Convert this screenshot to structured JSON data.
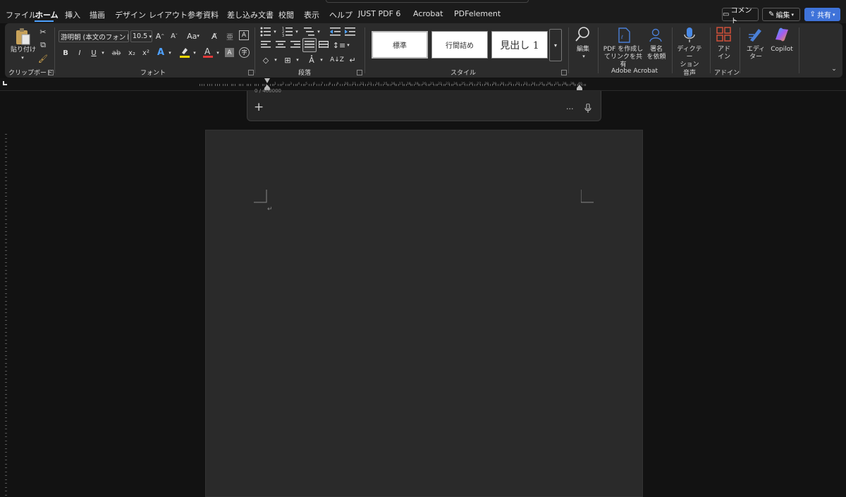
{
  "tabs": [
    "ファイル",
    "ホーム",
    "挿入",
    "描画",
    "デザイン",
    "レイアウト",
    "参考資料",
    "差し込み文書",
    "校閲",
    "表示",
    "ヘルプ",
    "JUST PDF 6",
    "Acrobat",
    "PDFelement"
  ],
  "top_buttons": {
    "comment": "コメント",
    "edit": "編集",
    "share": "共有"
  },
  "clipboard": {
    "paste_label": "貼り付け",
    "group": "クリップボード"
  },
  "font": {
    "name": "游明朝 (本文のフォント",
    "size": "10.5",
    "group": "フォント",
    "change_case": "Aa",
    "bold": "B",
    "italic": "I",
    "underline": "U",
    "strike": "ab",
    "subscript": "x₂",
    "superscript": "x²"
  },
  "paragraph": {
    "group": "段落"
  },
  "styles": {
    "items": [
      "標準",
      "行間詰め",
      "見出し 1"
    ],
    "group": "スタイル"
  },
  "editing": {
    "label": "編集"
  },
  "adobe": {
    "create_share": "PDF を作成し\nてリンクを共有",
    "request_sign": "署名\nを依頼",
    "group": "Adobe Acrobat"
  },
  "voice": {
    "dictate": "ディクテー\nション",
    "group": "音声"
  },
  "addins": {
    "label": "アド\nイン",
    "group": "アドイン"
  },
  "editor": {
    "label": "エディ\nター"
  },
  "copilot": {
    "label": "Copilot"
  },
  "ruler": {
    "numbers": [
      "1",
      "2",
      "3",
      "4",
      "5",
      "6",
      "7",
      "8",
      "9",
      "10",
      "11",
      "12",
      "13",
      "14",
      "15",
      "16",
      "17",
      "18",
      "19",
      "20",
      "21",
      "22",
      "23",
      "24",
      "25",
      "26",
      "27",
      "28",
      "29",
      "30",
      "31",
      "32",
      "33",
      "34",
      "35",
      "36",
      "37",
      "38",
      "39",
      "40"
    ]
  },
  "chatbox": {
    "counter": "0 / 400000"
  },
  "document": {
    "paragraph_mark": "↵"
  },
  "colors": {
    "accent": "#4ea1ff",
    "share": "#3f73d9",
    "page": "#2a2a2a",
    "bg": "#121212",
    "ribbon": "#2c2c2c",
    "highlight": "#f2d600",
    "font_color": "#e03a3a"
  }
}
